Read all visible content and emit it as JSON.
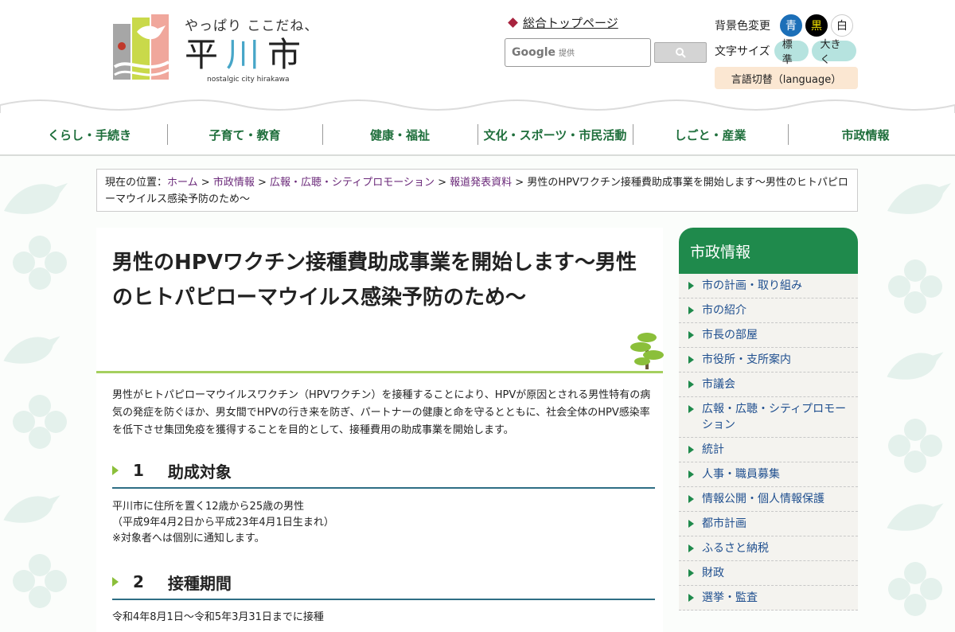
{
  "header": {
    "catchphrase": "やっぱり ここだね、",
    "city_name_a": "平",
    "city_name_b": "川",
    "city_name_c": "市",
    "city_sub": "nostalgic city hirakawa",
    "top_link": "総合トップページ",
    "search_placeholder_brand": "Google",
    "search_placeholder_suffix": "提供",
    "bg_label": "背景色変更",
    "bg_options": [
      "青",
      "黒",
      "白"
    ],
    "font_label": "文字サイズ",
    "font_options": [
      "標準",
      "大きく"
    ],
    "language": "言語切替（language）"
  },
  "nav": {
    "items": [
      "くらし・手続き",
      "子育て・教育",
      "健康・福祉",
      "文化・スポーツ・市民活動",
      "しごと・産業",
      "市政情報"
    ]
  },
  "breadcrumb": {
    "prefix": "現在の位置：",
    "links": [
      "ホーム",
      "市政情報",
      "広報・広聴・シティプロモーション",
      "報道発表資料"
    ],
    "sep": " > ",
    "current": "男性のHPVワクチン接種費助成事業を開始します～男性のヒトパピローマウイルス感染予防のため～"
  },
  "main": {
    "title": "男性のHPVワクチン接種費助成事業を開始します～男性のヒトパピローマウイルス感染予防のため～",
    "lead": "男性がヒトパピローマウイルスワクチン（HPVワクチン）を接種することにより、HPVが原因とされる男性特有の病気の発症を防ぐほか、男女間でHPVの行き来を防ぎ、パートナーの健康と命を守るとともに、社会全体のHPV感染率を低下させ集団免疫を獲得することを目的として、接種費用の助成事業を開始します。",
    "sections": [
      {
        "num": "1",
        "heading": "助成対象",
        "lines": [
          "平川市に住所を置く12歳から25歳の男性",
          "（平成9年4月2日から平成23年4月1日生まれ）",
          "※対象者へは個別に通知します。"
        ]
      },
      {
        "num": "2",
        "heading": "接種期間",
        "lines": [
          "令和4年8月1日～令和5年3月31日までに接種"
        ]
      }
    ]
  },
  "sidebar": {
    "title": "市政情報",
    "items": [
      "市の計画・取り組み",
      "市の紹介",
      "市長の部屋",
      "市役所・支所案内",
      "市議会",
      "広報・広聴・シティプロモーション",
      "統計",
      "人事・職員募集",
      "情報公開・個人情報保護",
      "都市計画",
      "ふるさと納税",
      "財政",
      "選挙・監査"
    ]
  },
  "colors": {
    "nav_text": "#1f6f3c",
    "sidebar_head": "#1f8a4c",
    "title_rule": "#a5cf5f",
    "section_rule": "#2e6e85",
    "link_purple": "#6b2a7a"
  }
}
